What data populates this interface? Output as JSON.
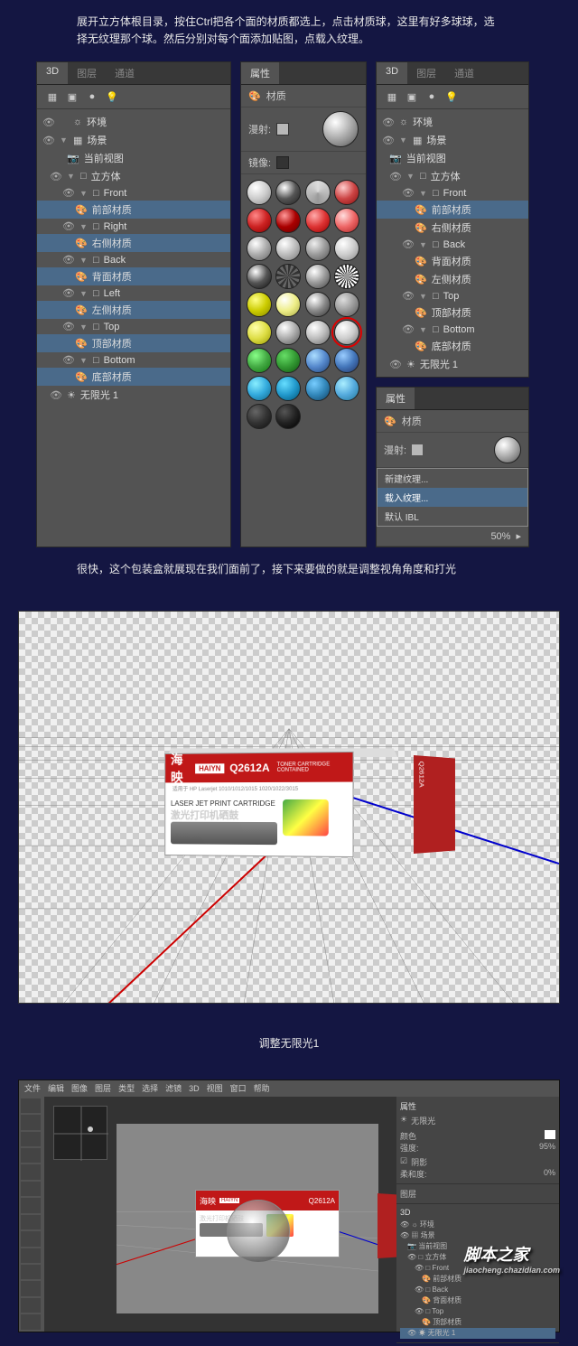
{
  "instructions": {
    "text1": "展开立方体根目录，按住Ctrl把各个面的材质都选上，点击材质球，这里有好多球球，选择无纹理那个球。然后分别对每个面添加贴图，点载入纹理。",
    "text2": "很快，这个包装盒就展现在我们面前了，接下来要做的就是调整视角角度和打光",
    "text3": "调整无限光1"
  },
  "tabs": {
    "tab3d": "3D",
    "layers": "图层",
    "channels": "通道",
    "props": "属性",
    "material": "材质"
  },
  "tree": {
    "env": "环境",
    "scene": "场景",
    "currentView": "当前视图",
    "cube": "立方体",
    "front": "Front",
    "frontMat": "前部材质",
    "right": "Right",
    "rightMat": "右侧材质",
    "back": "Back",
    "backMat": "背面材质",
    "left": "Left",
    "leftMat": "左侧材质",
    "top": "Top",
    "topMat": "顶部材质",
    "bottom": "Bottom",
    "bottomMat": "底部材质",
    "infiniteLight": "无限光 1"
  },
  "props": {
    "diffuse": "漫射:",
    "mirror": "镜像:"
  },
  "contextMenu": {
    "newTexture": "新建纹理...",
    "loadTexture": "载入纹理...",
    "defaultIBL": "默认 IBL"
  },
  "materials": [
    {
      "bg": "radial-gradient(circle at 35% 30%,#fff,#ccc,#888)"
    },
    {
      "bg": "radial-gradient(circle at 35% 30%,#fff,#555,#222)"
    },
    {
      "bg": "conic-gradient(#ddd,#999,#ddd)"
    },
    {
      "bg": "radial-gradient(circle at 35% 30%,#fcc,#c44,#811)"
    },
    {
      "bg": "radial-gradient(circle at 35% 30%,#f88,#c22,#800)"
    },
    {
      "bg": "radial-gradient(circle at 35% 30%,#f99,#a00,#600)"
    },
    {
      "bg": "radial-gradient(circle at 35% 30%,#faa,#d33,#900)"
    },
    {
      "bg": "radial-gradient(circle at 35% 30%,#fdd,#e66,#a22)"
    },
    {
      "bg": "radial-gradient(circle at 35% 30%,#fff,#aaa,#666)"
    },
    {
      "bg": "radial-gradient(circle at 35% 30%,#fff,#bbb,#777)"
    },
    {
      "bg": "radial-gradient(circle at 35% 30%,#eee,#999,#555)"
    },
    {
      "bg": "radial-gradient(circle at 35% 30%,#fff,#ccc,#888)"
    },
    {
      "bg": "radial-gradient(circle at 35% 30%,#fff,#555,#111)"
    },
    {
      "bg": "repeating-conic-gradient(#333 0 15deg,#666 15deg 30deg)"
    },
    {
      "bg": "radial-gradient(circle at 35% 30%,#fff,#999,#444)"
    },
    {
      "bg": "repeating-conic-gradient(#fff 0 10deg,#333 10deg 20deg)"
    },
    {
      "bg": "radial-gradient(circle at 35% 30%,#ff8,#cc0,#880)"
    },
    {
      "bg": "radial-gradient(circle at 35% 30%,#fff,#ee8,#aa4)"
    },
    {
      "bg": "radial-gradient(circle at 35% 30%,#fff,#888,#333)"
    },
    {
      "bg": "radial-gradient(circle at 35% 30%,#ddd,#999,#555)"
    },
    {
      "bg": "radial-gradient(circle at 35% 30%,#ffa,#dd4,#990)"
    },
    {
      "bg": "radial-gradient(circle at 35% 30%,#fff,#aaa,#555)"
    },
    {
      "bg": "radial-gradient(circle at 35% 30%,#fff,#bbb,#666)"
    },
    {
      "bg": "radial-gradient(circle at 35% 30%,#fff,#ccc,#777)",
      "circled": true
    },
    {
      "bg": "radial-gradient(circle at 35% 30%,#8f8,#4a4,#171)"
    },
    {
      "bg": "radial-gradient(circle at 35% 30%,#6d6,#393,#151)"
    },
    {
      "bg": "radial-gradient(circle at 35% 30%,#adf,#58c,#247)"
    },
    {
      "bg": "radial-gradient(circle at 35% 30%,#9cf,#47b,#236)"
    },
    {
      "bg": "radial-gradient(circle at 35% 30%,#8ef,#3ad,#168)"
    },
    {
      "bg": "radial-gradient(circle at 35% 30%,#6df,#29c,#057)"
    },
    {
      "bg": "radial-gradient(circle at 35% 30%,#7cf,#38b,#146)"
    },
    {
      "bg": "radial-gradient(circle at 35% 30%,#aef,#5ad,#279)"
    },
    {
      "bg": "radial-gradient(circle at 35% 30%,#666,#333,#111)"
    },
    {
      "bg": "radial-gradient(circle at 35% 30%,#555,#222,#000)"
    }
  ],
  "box": {
    "brandCn": "海映",
    "brandEn": "HAIYN",
    "model": "Q2612A",
    "tonerBadge": "TONER CARTRIDGE CONTAINED",
    "subtitle": "适用于",
    "compat": "HP Laserjet 1010/1012/1015 1020/1022/3015",
    "cartridgeLabel": "LASER JET PRINT CARTRIDGE",
    "productCn": "激光打印机硒鼓"
  },
  "psMenu": [
    "文件",
    "编辑",
    "图像",
    "图层",
    "类型",
    "选择",
    "滤镜",
    "3D",
    "视图",
    "窗口",
    "帮助"
  ],
  "psPanels": {
    "props": "属性",
    "infiniteLight": "无限光",
    "color": "颜色",
    "intensity": "强度:",
    "intensityVal": "95%",
    "shadow": "阴影",
    "softness": "柔和度:",
    "softnessVal": "0%",
    "layers": "图层",
    "tree3d": "3D"
  },
  "watermark": {
    "main": "脚本之家",
    "sub": "jiaocheng.chazidian.com"
  },
  "opacity": "50%"
}
